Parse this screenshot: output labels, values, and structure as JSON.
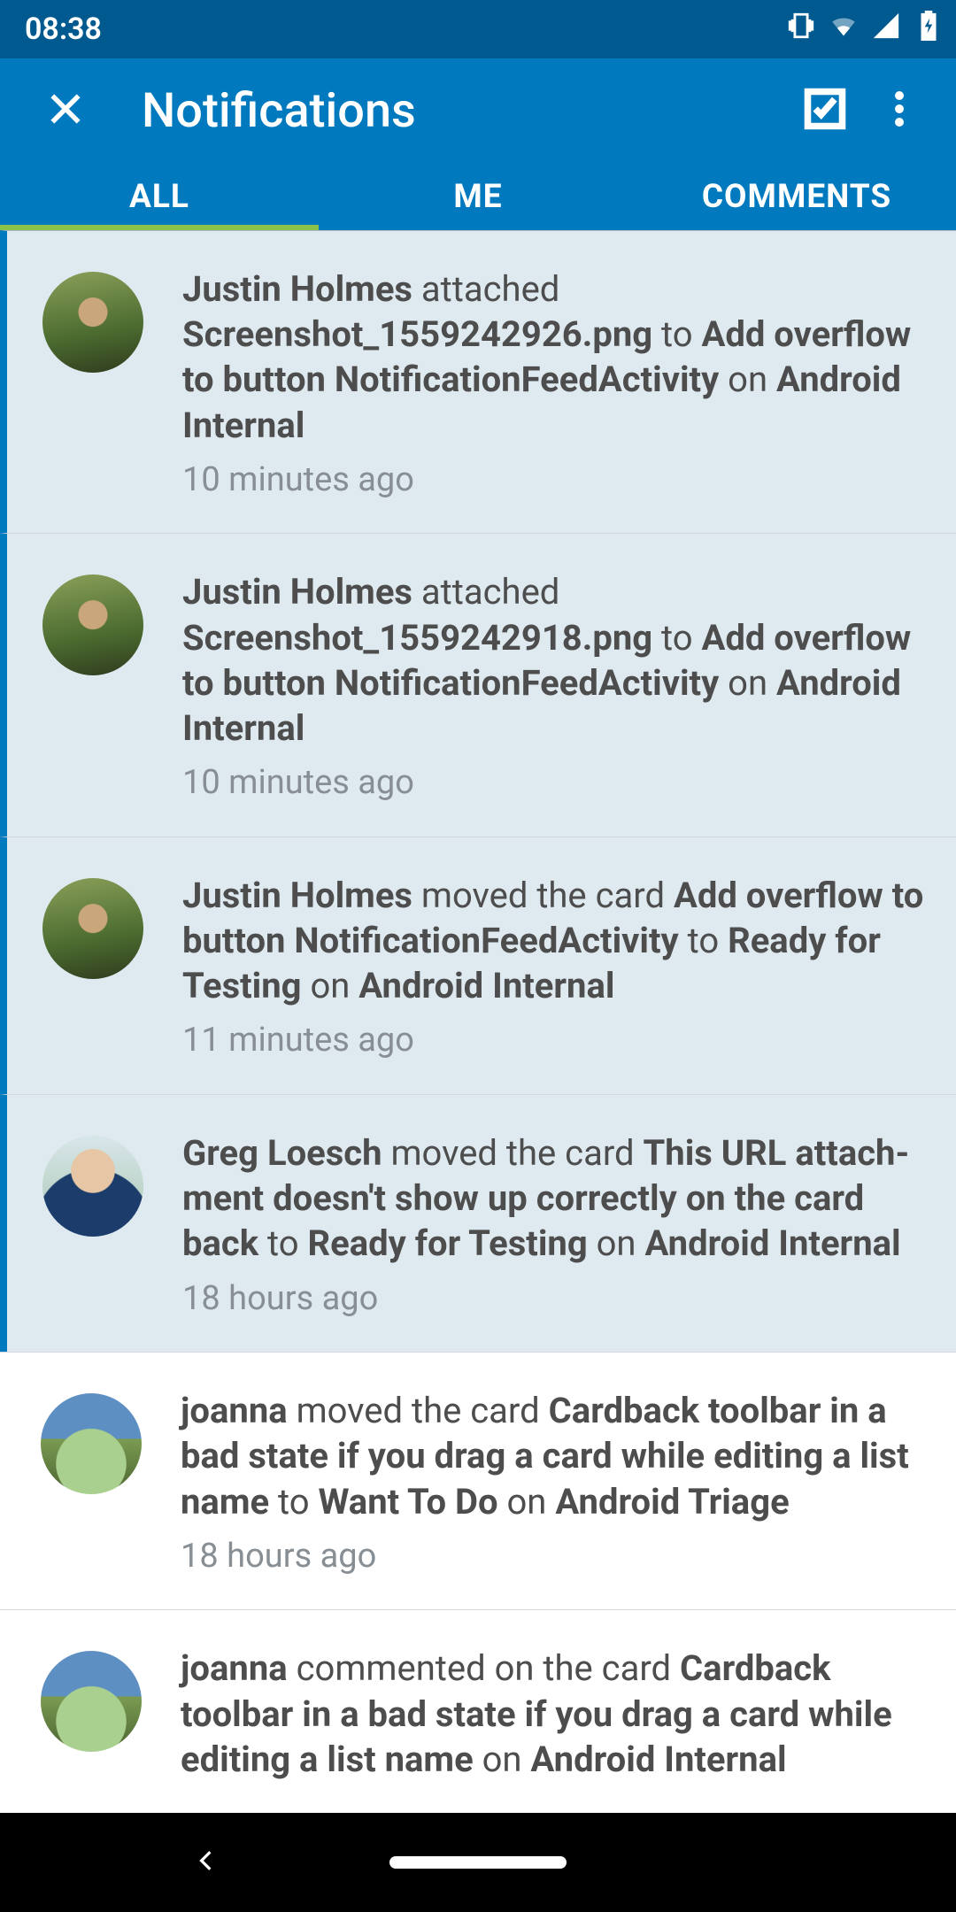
{
  "status": {
    "time": "08:38"
  },
  "header": {
    "title": "Notifications"
  },
  "tabs": {
    "all": "ALL",
    "me": "ME",
    "comments": "COMMENTS",
    "active_index": 0
  },
  "notifications": [
    {
      "unread": true,
      "avatar": "justin",
      "actor": "Justin Holmes",
      "verb": " attached ",
      "obj1": "Screenshot_1559242926.png",
      "to1": " to ",
      "obj2": "Add overflow to button NotificationFeedActivity",
      "on": " on ",
      "board": "Android Internal",
      "time": "10 minutes ago"
    },
    {
      "unread": true,
      "avatar": "justin",
      "actor": "Justin Holmes",
      "verb": " attached ",
      "obj1": "Screenshot_1559242918.png",
      "to1": " to ",
      "obj2": "Add overflow to button NotificationFeedActivity",
      "on": " on ",
      "board": "Android Internal",
      "time": "10 minutes ago"
    },
    {
      "unread": true,
      "avatar": "justin",
      "actor": "Justin Holmes",
      "verb": " moved the card ",
      "obj1": "Add overflow to button NotificationFeedActivity",
      "to1": " to ",
      "obj2": "Ready for Testing",
      "on": " on ",
      "board": "Android Internal",
      "time": "11 minutes ago"
    },
    {
      "unread": true,
      "avatar": "greg",
      "actor": "Greg Loesch",
      "verb": " moved the card ",
      "obj1": "This URL attach­ment doesn't show up correctly on the card back",
      "to1": " to ",
      "obj2": "Ready for Testing",
      "on": " on ",
      "board": "Android Internal",
      "time": "18 hours ago"
    },
    {
      "unread": false,
      "avatar": "joanna",
      "actor": "joanna",
      "verb": " moved the card ",
      "obj1": "Cardback toolbar in a bad state if you drag a card while editing a list name",
      "to1": " to ",
      "obj2": "Want To Do",
      "on": " on ",
      "board": "Android Triage",
      "time": "18 hours ago"
    },
    {
      "unread": false,
      "avatar": "joanna",
      "actor": "joanna",
      "verb": " commented on the card ",
      "obj1": "Cardback toolbar in a bad state if you drag a card while editing a list name",
      "to1": "",
      "obj2": "",
      "on": " on ",
      "board": "Android Internal",
      "time": ""
    }
  ]
}
